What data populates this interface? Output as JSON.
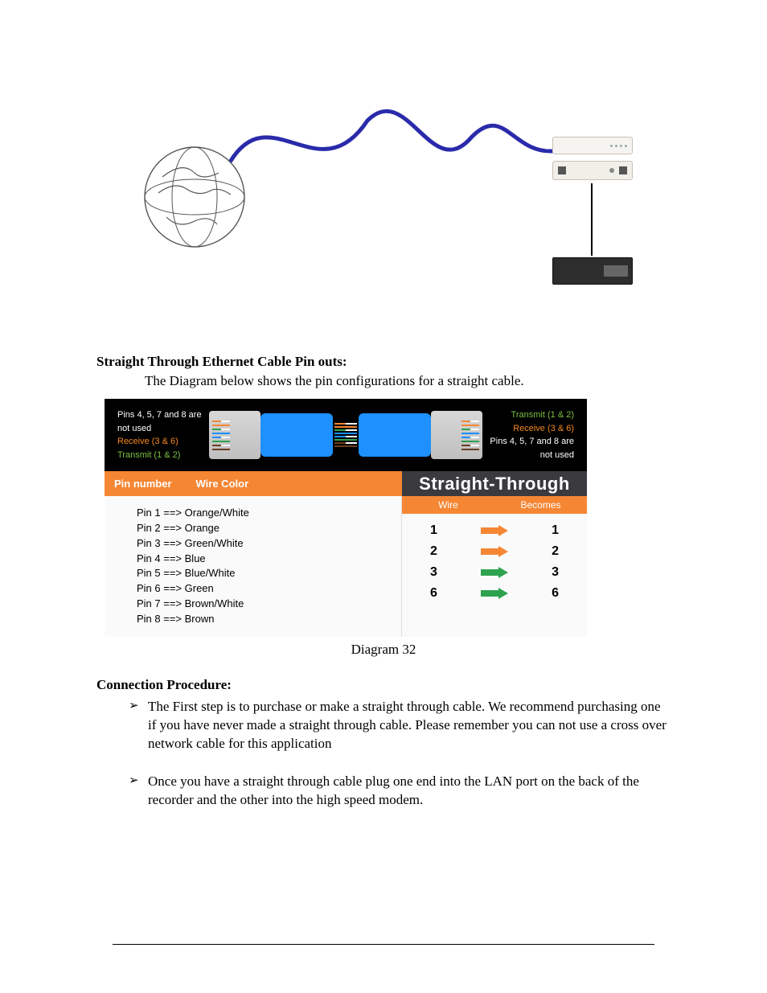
{
  "section1": {
    "title": "Straight Through Ethernet Cable Pin outs:",
    "intro": "The Diagram below shows the pin configurations for a straight cable."
  },
  "pinout": {
    "left_labels": {
      "not_used": "Pins 4, 5, 7 and 8 are not used",
      "receive": "Receive (3 & 6)",
      "transmit": "Transmit (1 & 2)"
    },
    "right_labels": {
      "transmit": "Transmit (1 & 2)",
      "receive": "Receive (3 & 6)",
      "not_used": "Pins 4, 5, 7 and 8 are not used"
    },
    "header_left": {
      "col1": "Pin number",
      "col2": "Wire Color"
    },
    "header_right": "Straight-Through",
    "pins": [
      "Pin 1 ==> Orange/White",
      "Pin 2 ==> Orange",
      "Pin 3 ==> Green/White",
      "Pin 4 ==> Blue",
      "Pin 5 ==> Blue/White",
      "Pin 6 ==> Green",
      "Pin 7 ==> Brown/White",
      "Pin 8 ==> Brown"
    ],
    "subhead": {
      "wire": "Wire",
      "becomes": "Becomes"
    },
    "map": [
      {
        "from": "1",
        "to": "1",
        "color": "#f58634"
      },
      {
        "from": "2",
        "to": "2",
        "color": "#f58634"
      },
      {
        "from": "3",
        "to": "3",
        "color": "#2fa24f"
      },
      {
        "from": "6",
        "to": "6",
        "color": "#2fa24f"
      }
    ],
    "caption": "Diagram 32"
  },
  "section2": {
    "title": "Connection Procedure:",
    "items": [
      "The First step is to purchase or make a straight through cable. We recommend purchasing one if you have never made a straight through cable. Please remember you can not use a cross over network cable for this application",
      "Once you have a straight through cable plug one end into the LAN port on the back of the recorder and the other into the high speed modem."
    ]
  }
}
